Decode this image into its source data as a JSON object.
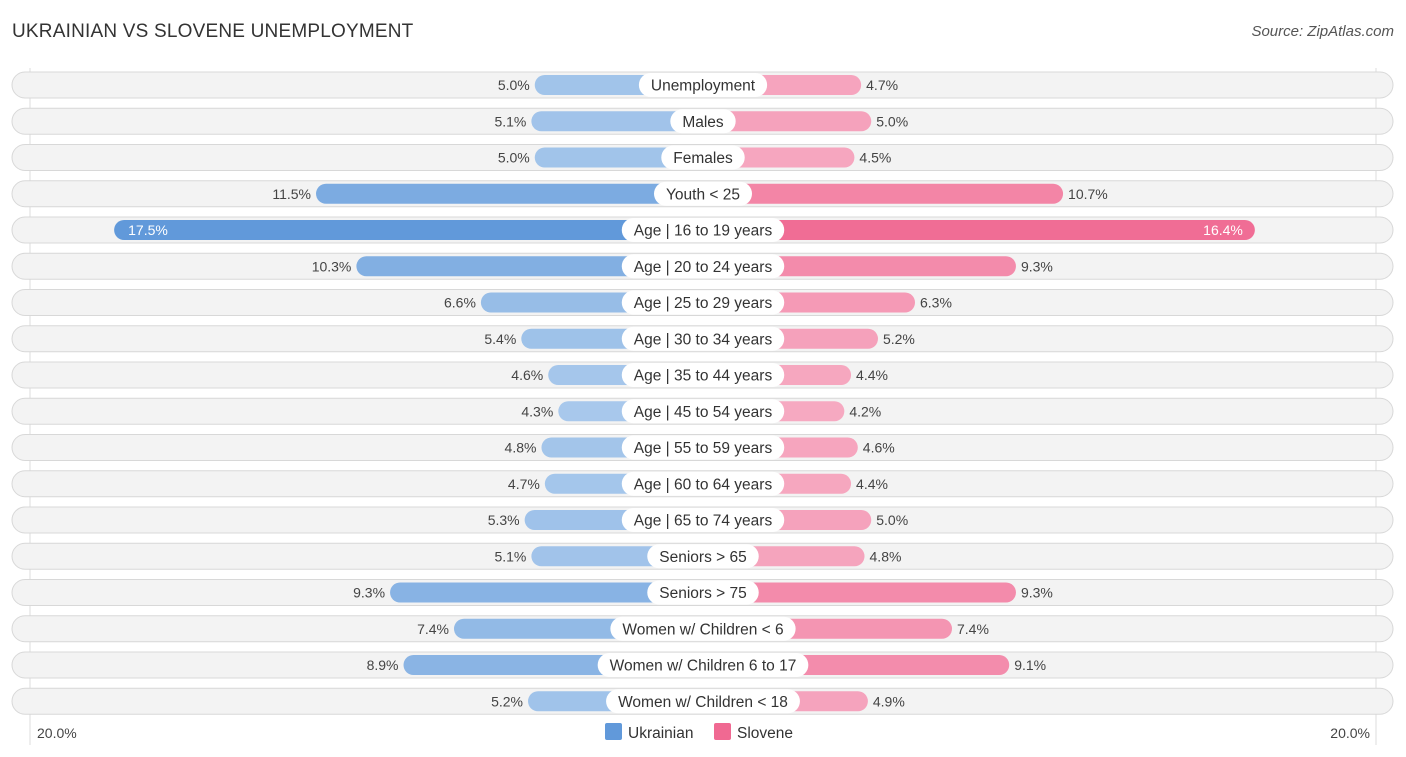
{
  "header": {
    "title": "UKRAINIAN VS SLOVENE UNEMPLOYMENT",
    "source": "Source: ZipAtlas.com"
  },
  "colors": {
    "ukrainian_light": "#a9c9ec",
    "ukrainian_strong": "#6199da",
    "slovene_light": "#f6a9c1",
    "slovene_strong": "#f06992"
  },
  "chart_data": {
    "type": "bar",
    "orientation": "horizontal-diverging",
    "title": "UKRAINIAN VS SLOVENE UNEMPLOYMENT",
    "categories": [
      "Unemployment",
      "Males",
      "Females",
      "Youth < 25",
      "Age | 16 to 19 years",
      "Age | 20 to 24 years",
      "Age | 25 to 29 years",
      "Age | 30 to 34 years",
      "Age | 35 to 44 years",
      "Age | 45 to 54 years",
      "Age | 55 to 59 years",
      "Age | 60 to 64 years",
      "Age | 65 to 74 years",
      "Seniors > 65",
      "Seniors > 75",
      "Women w/ Children < 6",
      "Women w/ Children 6 to 17",
      "Women w/ Children < 18"
    ],
    "series": [
      {
        "name": "Ukrainian",
        "side": "left",
        "values": [
          5.0,
          5.1,
          5.0,
          11.5,
          17.5,
          10.3,
          6.6,
          5.4,
          4.6,
          4.3,
          4.8,
          4.7,
          5.3,
          5.1,
          9.3,
          7.4,
          8.9,
          5.2
        ],
        "labels": [
          "5.0%",
          "5.1%",
          "5.0%",
          "11.5%",
          "17.5%",
          "10.3%",
          "6.6%",
          "5.4%",
          "4.6%",
          "4.3%",
          "4.8%",
          "4.7%",
          "5.3%",
          "5.1%",
          "9.3%",
          "7.4%",
          "8.9%",
          "5.2%"
        ]
      },
      {
        "name": "Slovene",
        "side": "right",
        "values": [
          4.7,
          5.0,
          4.5,
          10.7,
          16.4,
          9.3,
          6.3,
          5.2,
          4.4,
          4.2,
          4.6,
          4.4,
          5.0,
          4.8,
          9.3,
          7.4,
          9.1,
          4.9
        ],
        "labels": [
          "4.7%",
          "5.0%",
          "4.5%",
          "10.7%",
          "16.4%",
          "9.3%",
          "6.3%",
          "5.2%",
          "4.4%",
          "4.2%",
          "4.6%",
          "4.4%",
          "5.0%",
          "4.8%",
          "9.3%",
          "7.4%",
          "9.1%",
          "4.9%"
        ]
      }
    ],
    "axis": {
      "max": 20.0,
      "left_label": "20.0%",
      "right_label": "20.0%"
    },
    "legend": {
      "position": "bottom-center",
      "items": [
        "Ukrainian",
        "Slovene"
      ]
    },
    "unit": "%"
  }
}
